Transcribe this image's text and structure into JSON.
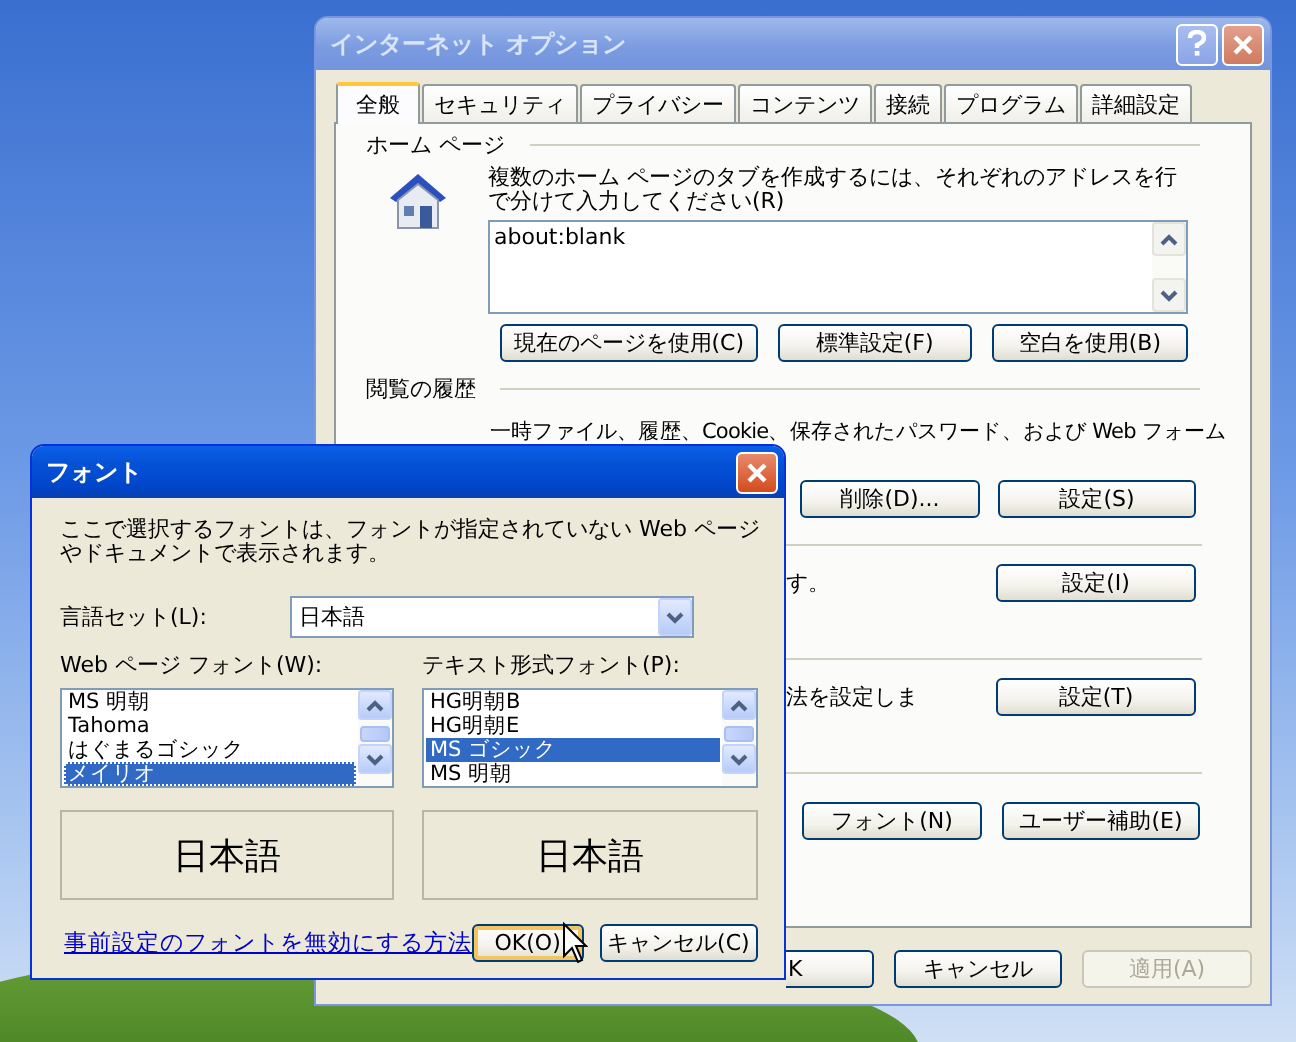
{
  "internet_options": {
    "title": "インターネット オプション",
    "active": false,
    "tabs": [
      {
        "label": "全般",
        "selected": true
      },
      {
        "label": "セキュリティ",
        "selected": false
      },
      {
        "label": "プライバシー",
        "selected": false
      },
      {
        "label": "コンテンツ",
        "selected": false
      },
      {
        "label": "接続",
        "selected": false
      },
      {
        "label": "プログラム",
        "selected": false
      },
      {
        "label": "詳細設定",
        "selected": false
      }
    ],
    "home_page": {
      "heading": "ホーム ページ",
      "description": "複数のホーム ページのタブを作成するには、それぞれのアドレスを行で分けて入力してください(R)",
      "addresses": "about:blank",
      "buttons": [
        "現在のページを使用(C)",
        "標準設定(F)",
        "空白を使用(B)"
      ]
    },
    "history": {
      "heading": "閲覧の履歴",
      "description": "一時ファイル、履歴、Cookie、保存されたパスワード、および Web フォーム",
      "buttons": [
        "削除(D)...",
        "設定(S)"
      ]
    },
    "section_3": {
      "text": "す。",
      "button": "設定(I)"
    },
    "section_4": {
      "text": "法を設定しま",
      "button": "設定(T)"
    },
    "section_5": {
      "buttons": [
        "フォント(N)",
        "ユーザー補助(E)"
      ]
    },
    "footer_buttons": [
      {
        "label": "K",
        "disabled": false
      },
      {
        "label": "キャンセル",
        "disabled": false
      },
      {
        "label": "適用(A)",
        "disabled": true
      }
    ]
  },
  "font_dialog": {
    "title": "フォント",
    "active": true,
    "description": "ここで選択するフォントは、フォントが指定されていない Web ページやドキュメントで表示されます。",
    "language_label": "言語セット(L):",
    "language_value": "日本語",
    "web_font_label": "Web ページ フォント(W):",
    "web_fonts": [
      {
        "name": "MS 明朝",
        "selected": false
      },
      {
        "name": "Tahoma",
        "selected": false
      },
      {
        "name": "はぐまるゴシック",
        "selected": false
      },
      {
        "name": "メイリオ",
        "selected": true
      }
    ],
    "web_preview": "日本語",
    "text_font_label": "テキスト形式フォント(P):",
    "text_fonts": [
      {
        "name": "HG明朝B",
        "selected": false
      },
      {
        "name": "HG明朝E",
        "selected": false
      },
      {
        "name": "MS ゴシック",
        "selected": true
      },
      {
        "name": "MS 明朝",
        "selected": false
      }
    ],
    "text_preview": "日本語",
    "link": "事前設定のフォントを無効にする方法",
    "buttons": [
      {
        "label": "OK(O)",
        "default": true
      },
      {
        "label": "キャンセル(C)",
        "default": false
      }
    ]
  }
}
